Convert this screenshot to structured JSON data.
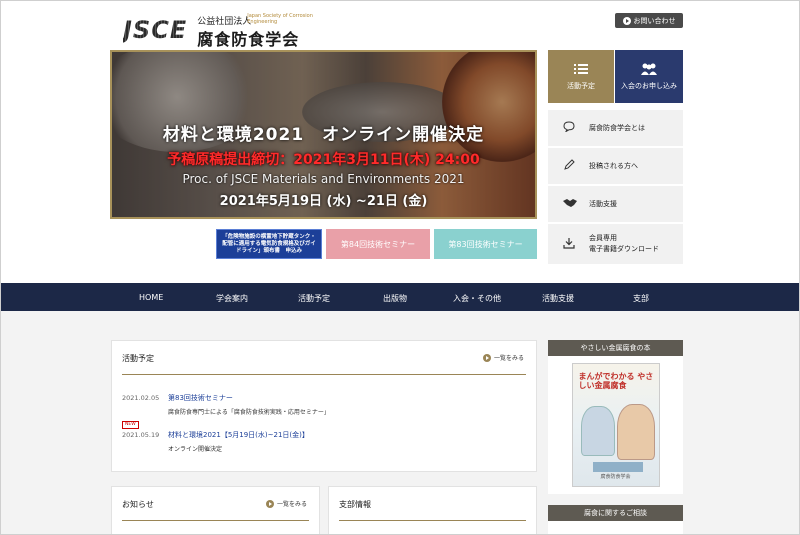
{
  "header": {
    "logo_mark": "JSCE",
    "corp_type": "公益社団法人",
    "org_en": "Japan Society of Corrosion Engineering",
    "org_name": "腐食防食学会",
    "contact_label": "お問い合わせ"
  },
  "hero": {
    "line1": "材料と環境2021　オンライン開催決定",
    "line2": "予稿原稿提出締切：2021年3月11日(木) 24:00",
    "line3": "Proc. of JSCE Materials and Environments 2021",
    "line4": "2021年5月19日 (水) ~21日 (金)"
  },
  "banners": [
    {
      "label": "「危険物施設の横置地下貯蔵タンク・配管に適用する電気防食規格及びガイドライン」頒布書　申込み",
      "color": "#1c3f98"
    },
    {
      "label": "第84回技術セミナー",
      "color": "#e9a0a8"
    },
    {
      "label": "第83回技術セミナー",
      "color": "#8ad1cf"
    }
  ],
  "right_menu": {
    "schedule_label": "活動予定",
    "join_label": "入会のお申し込み",
    "items": [
      {
        "label": "腐食防食学会とは",
        "icon": "speech-bubble-icon"
      },
      {
        "label": "投稿される方へ",
        "icon": "pencil-icon"
      },
      {
        "label": "活動支援",
        "icon": "handshake-icon"
      },
      {
        "label": "会員専用",
        "label2": "電子書籍ダウンロード",
        "icon": "download-icon"
      }
    ]
  },
  "nav": [
    "HOME",
    "学会案内",
    "活動予定",
    "出版物",
    "入会・その他",
    "活動支援",
    "支部"
  ],
  "activity": {
    "title": "活動予定",
    "more": "一覧をみる",
    "events": [
      {
        "date": "2021.02.05",
        "title": "第83回技術セミナー",
        "sub": "腐食防食専門士による「腐食防食技術実践・応用セミナー」",
        "new": false
      },
      {
        "date": "2021.05.19",
        "title": "材料と環境2021【5月19日(水)~21日(金)】",
        "sub": "オンライン開催決定",
        "new": true,
        "new_label": "NEW"
      }
    ]
  },
  "news": {
    "title": "お知らせ",
    "more": "一覧をみる"
  },
  "branch": {
    "title": "支部情報"
  },
  "side": {
    "book_head": "やさしい金属腐食の本",
    "book_title": "まんがでわかる やさしい金属腐食",
    "book_foot": "腐食防食学会",
    "links_head": "腐食に関するご相談"
  },
  "colors": {
    "nav_bg": "#1c2847",
    "gold": "#9a8556",
    "join_bg": "#2a3a6e"
  }
}
